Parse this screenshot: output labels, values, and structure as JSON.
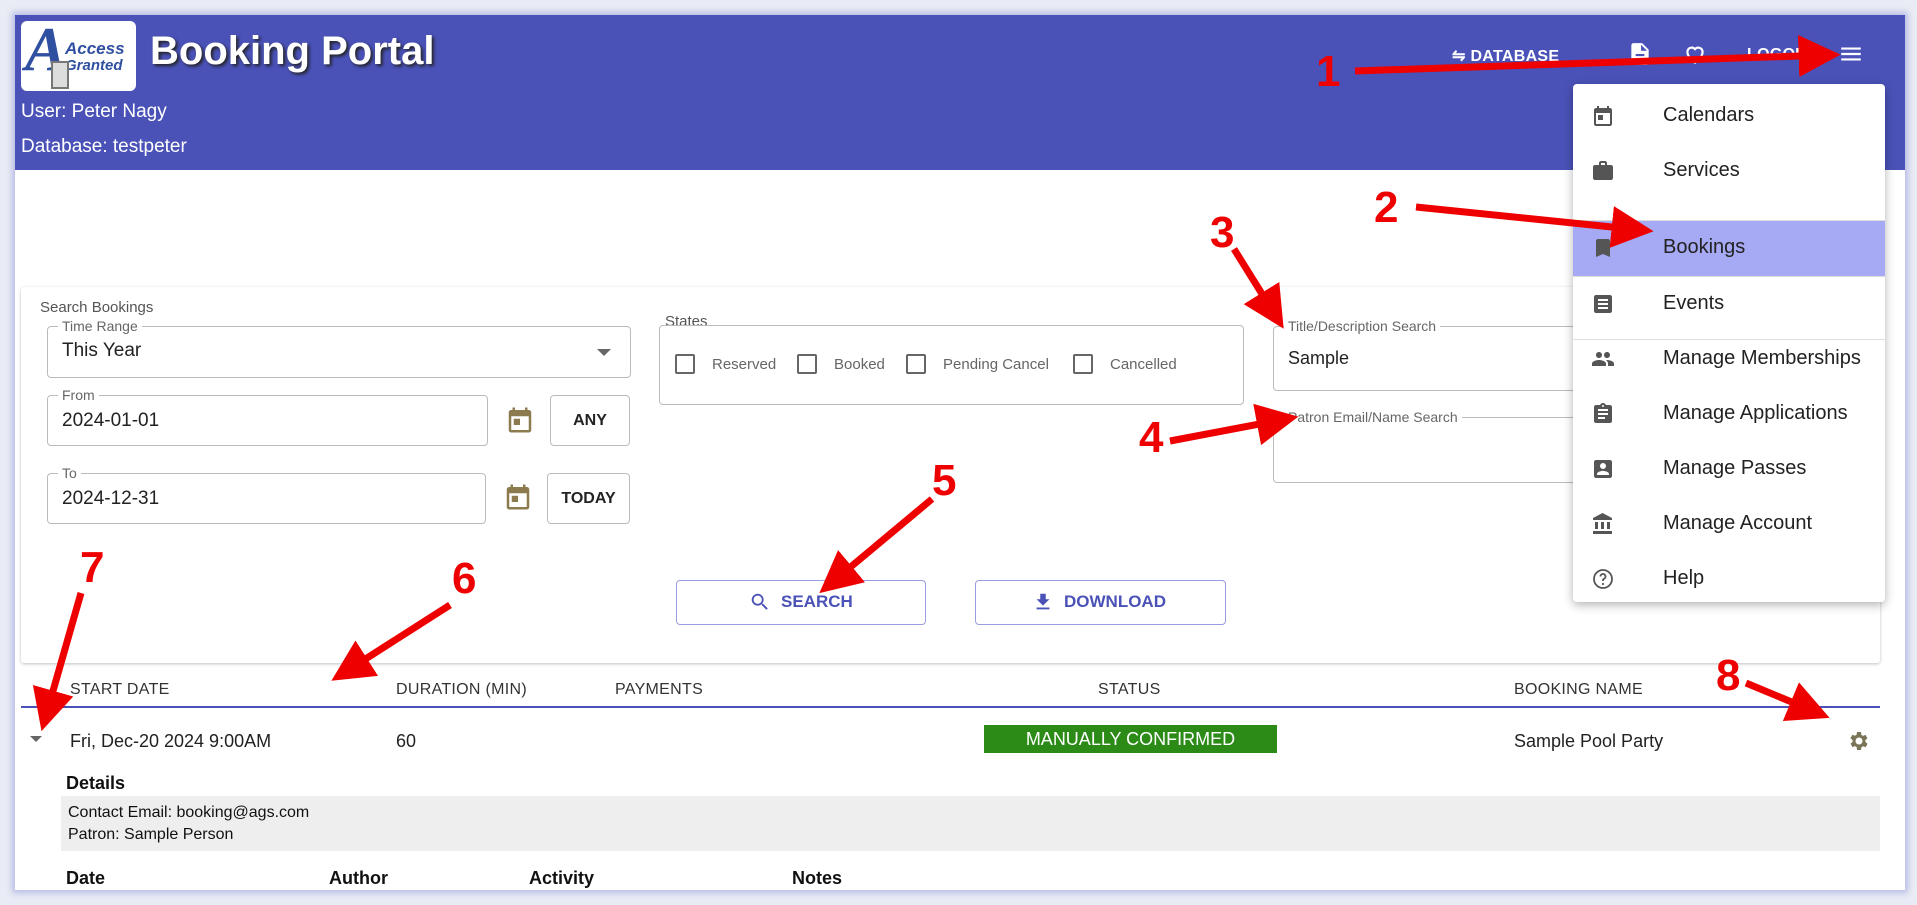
{
  "app": {
    "title": "Booking Portal",
    "logo_word1": "Access",
    "logo_word2": "Granted"
  },
  "user": {
    "user_line": "User: Peter Nagy",
    "db_line": "Database: testpeter"
  },
  "nav": {
    "database": "⇋ DATABASE",
    "logout": "LOGOUT"
  },
  "menu": {
    "items": [
      {
        "label": "Calendars",
        "icon": "calendar-icon"
      },
      {
        "label": "Services",
        "icon": "briefcase-icon"
      },
      {
        "label": "Bookings",
        "icon": "bookmark-icon",
        "active": true
      },
      {
        "label": "Events",
        "icon": "list-icon"
      },
      {
        "label": "Manage Memberships",
        "icon": "people-icon"
      },
      {
        "label": "Manage Applications",
        "icon": "clipboard-icon"
      },
      {
        "label": "Manage Passes",
        "icon": "badge-icon"
      },
      {
        "label": "Manage Account",
        "icon": "bank-icon"
      },
      {
        "label": "Help",
        "icon": "help-icon"
      }
    ]
  },
  "search": {
    "title": "Search Bookings",
    "time_range_label": "Time Range",
    "time_range_value": "This Year",
    "from_label": "From",
    "from_value": "2024-01-01",
    "any_label": "ANY",
    "to_label": "To",
    "to_value": "2024-12-31",
    "today_label": "TODAY",
    "states_label": "States",
    "states": [
      "Reserved",
      "Booked",
      "Pending Cancel",
      "Cancelled"
    ],
    "title_search_label": "Title/Description Search",
    "title_search_value": "Sample",
    "patron_search_label": "Patron Email/Name Search",
    "patron_search_value": "",
    "search_button": "SEARCH",
    "download_button": "DOWNLOAD"
  },
  "table": {
    "headers": [
      "START DATE",
      "DURATION (MIN)",
      "PAYMENTS",
      "STATUS",
      "BOOKING NAME"
    ],
    "row": {
      "start_date": "Fri, Dec-20 2024 9:00AM",
      "duration": "60",
      "payments": "",
      "status": "MANUALLY CONFIRMED",
      "booking_name": "Sample Pool Party"
    },
    "details_title": "Details",
    "contact_email": "Contact Email: booking@ags.com",
    "patron": "Patron: Sample Person",
    "sub_headers": [
      "Date",
      "Author",
      "Activity",
      "Notes"
    ]
  },
  "annotations": [
    "1",
    "2",
    "3",
    "4",
    "5",
    "6",
    "7",
    "8"
  ],
  "colors": {
    "appbar": "#4a52b8",
    "active_menu": "#a6a9f3",
    "status_green": "#2b8b16",
    "annotation_red": "#ef0000"
  }
}
